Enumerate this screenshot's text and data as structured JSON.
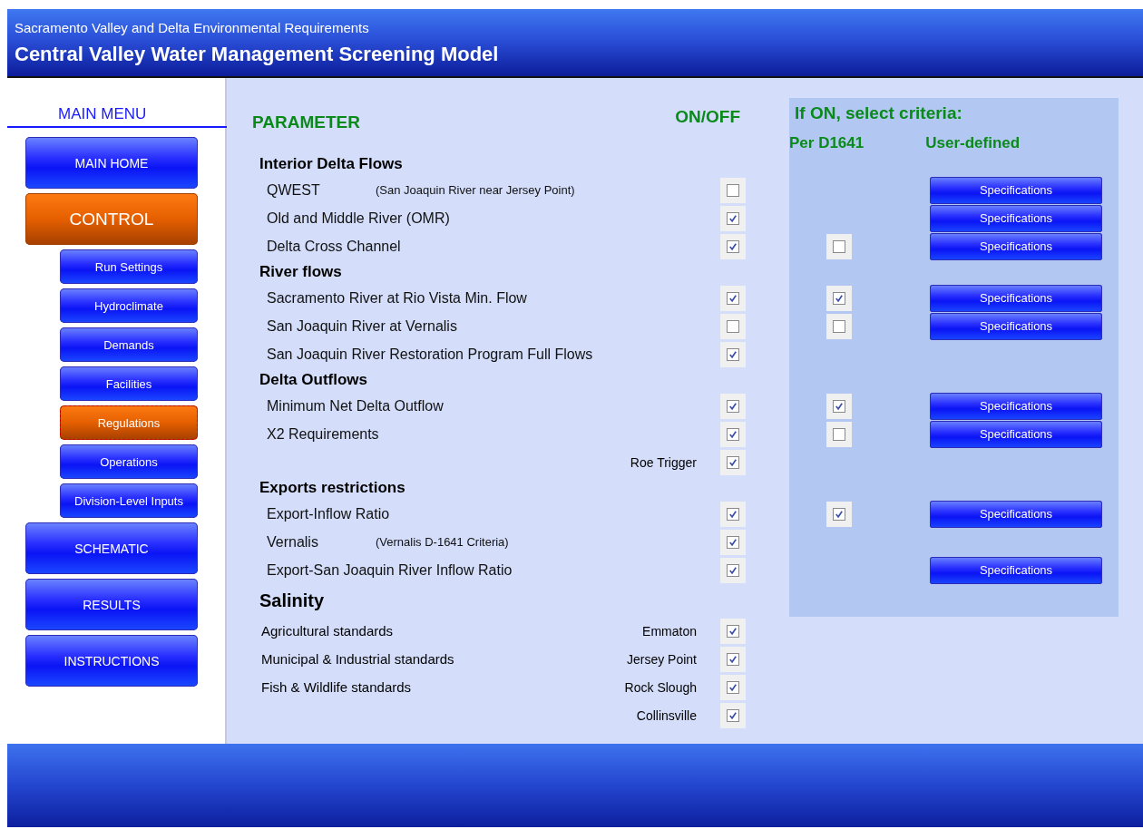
{
  "header": {
    "subtitle": "Sacramento Valley and Delta Environmental Requirements",
    "title": "Central Valley Water Management Screening Model"
  },
  "menu": {
    "title": "MAIN MENU",
    "items": [
      {
        "label": "MAIN HOME",
        "selected": false
      },
      {
        "label": "CONTROL",
        "selected": true,
        "children": [
          {
            "label": "Run Settings",
            "selected": false
          },
          {
            "label": "Hydroclimate",
            "selected": false
          },
          {
            "label": "Demands",
            "selected": false
          },
          {
            "label": "Facilities",
            "selected": false
          },
          {
            "label": "Regulations",
            "selected": true
          },
          {
            "label": "Operations",
            "selected": false
          },
          {
            "label": "Division-Level Inputs",
            "selected": false
          }
        ]
      },
      {
        "label": "SCHEMATIC",
        "selected": false
      },
      {
        "label": "RESULTS",
        "selected": false
      },
      {
        "label": "INSTRUCTIONS",
        "selected": false
      }
    ]
  },
  "columns": {
    "parameter": "PARAMETER",
    "on_off": "ON/OFF",
    "criteria": "If ON, select criteria:",
    "per_d1641": "Per D1641",
    "user_defined": "User-defined"
  },
  "sections": [
    {
      "title": "Interior Delta Flows",
      "items": [
        {
          "label": "QWEST",
          "note": "(San Joaquin River near Jersey Point)",
          "on": false,
          "spec": "Specifications"
        },
        {
          "label": "Old and Middle River (OMR)",
          "on": true,
          "spec": "Specifications"
        },
        {
          "label": "Delta Cross Channel",
          "on": true,
          "d1641": false,
          "spec": "Specifications"
        }
      ]
    },
    {
      "title": "River flows",
      "items": [
        {
          "label": "Sacramento River at Rio Vista Min. Flow",
          "on": true,
          "d1641": true,
          "spec": "Specifications"
        },
        {
          "label": "San Joaquin River at Vernalis",
          "on": false,
          "d1641": false,
          "spec": "Specifications"
        },
        {
          "label": "San Joaquin River Restoration Program Full Flows",
          "on": true
        }
      ]
    },
    {
      "title": "Delta Outflows",
      "items": [
        {
          "label": "Minimum Net Delta Outflow",
          "on": true,
          "d1641": true,
          "spec": "Specifications"
        },
        {
          "label": "X2 Requirements",
          "on": true,
          "d1641": false,
          "spec": "Specifications"
        },
        {
          "sublabel": "Roe Trigger",
          "on": true
        }
      ]
    },
    {
      "title": "Exports restrictions",
      "items": [
        {
          "label": "Export-Inflow Ratio",
          "on": true,
          "d1641": true,
          "spec": "Specifications"
        },
        {
          "label": "Vernalis",
          "note": "(Vernalis D-1641 Criteria)",
          "on": true
        },
        {
          "label": "Export-San Joaquin River Inflow Ratio",
          "on": true,
          "spec": "Specifications"
        }
      ]
    }
  ],
  "salinity": {
    "title": "Salinity",
    "standards": [
      "Agricultural standards",
      "Municipal & Industrial standards",
      "Fish & Wildlife standards"
    ],
    "stations": [
      {
        "label": "Emmaton",
        "on": true
      },
      {
        "label": "Jersey Point",
        "on": true
      },
      {
        "label": "Rock Slough",
        "on": true
      },
      {
        "label": "Collinsville",
        "on": true
      }
    ]
  }
}
